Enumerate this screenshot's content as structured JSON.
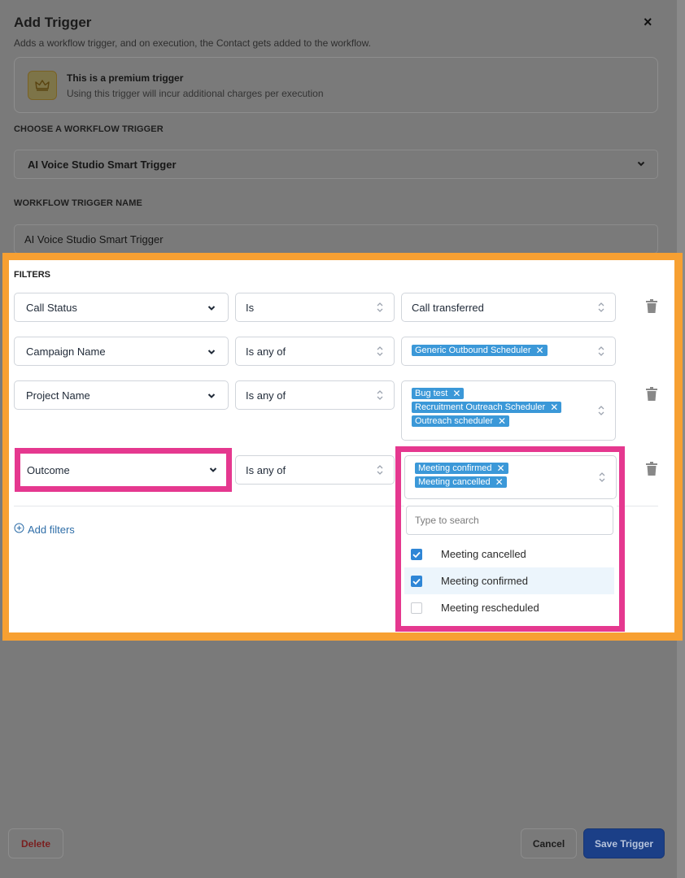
{
  "header": {
    "title": "Add Trigger",
    "close_glyph": "×",
    "subtitle": "Adds a workflow trigger, and on execution, the Contact gets added to the workflow."
  },
  "premium": {
    "icon": "crown-icon",
    "title": "This is a premium trigger",
    "description": "Using this trigger will incur additional charges per execution"
  },
  "trigger": {
    "choose_label": "CHOOSE A WORKFLOW TRIGGER",
    "selected": "AI Voice Studio Smart Trigger",
    "name_label": "WORKFLOW TRIGGER NAME",
    "name_value": "AI Voice Studio Smart Trigger"
  },
  "filters": {
    "label": "FILTERS",
    "rows": [
      {
        "field": "Call Status",
        "operator": "Is",
        "value": "Call transferred",
        "tags": []
      },
      {
        "field": "Campaign Name",
        "operator": "Is any of",
        "value": "",
        "tags": [
          "Generic Outbound Scheduler"
        ]
      },
      {
        "field": "Project Name",
        "operator": "Is any of",
        "value": "",
        "tags": [
          "Bug test",
          "Recruitment Outreach Scheduler",
          "Outreach scheduler"
        ]
      },
      {
        "field": "Outcome",
        "operator": "Is any of",
        "value": "",
        "tags": [
          "Meeting confirmed",
          "Meeting cancelled"
        ]
      }
    ],
    "add_label": "Add filters",
    "dropdown": {
      "search_placeholder": "Type to search",
      "options": [
        {
          "label": "Meeting cancelled",
          "checked": true
        },
        {
          "label": "Meeting confirmed",
          "checked": true
        },
        {
          "label": "Meeting rescheduled",
          "checked": false
        }
      ]
    }
  },
  "footer": {
    "delete_label": "Delete",
    "cancel_label": "Cancel",
    "save_label": "Save Trigger"
  },
  "colors": {
    "tag": "#3b98d8",
    "highlight_orange": "#f7a032",
    "highlight_pink": "#e5388f",
    "save_button": "#1b3f87"
  }
}
